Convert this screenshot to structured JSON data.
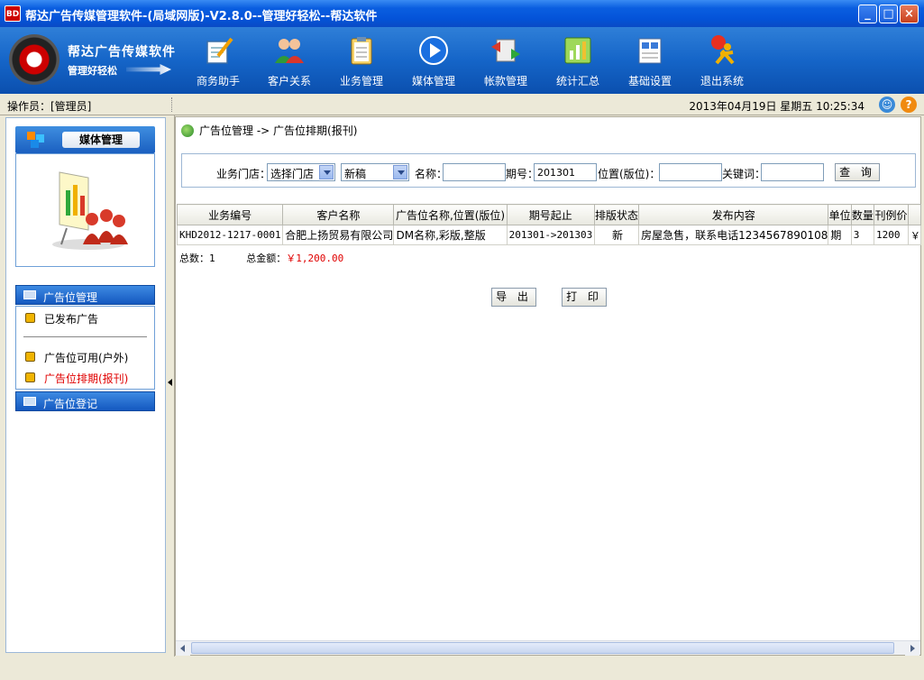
{
  "window": {
    "app_icon_text": "BD",
    "title": "帮达广告传媒管理软件-(局域网版)-V2.8.0--管理好轻松--帮达软件",
    "minimize": "_",
    "maximize": "□",
    "close": "×"
  },
  "logo": {
    "title": "帮达广告传媒软件",
    "subtitle": "管理好轻松"
  },
  "toolbar": [
    {
      "label": "商务助手",
      "icon": "notepad-pen-icon"
    },
    {
      "label": "客户关系",
      "icon": "people-icon"
    },
    {
      "label": "业务管理",
      "icon": "clipboard-icon"
    },
    {
      "label": "媒体管理",
      "icon": "play-icon"
    },
    {
      "label": "帐款管理",
      "icon": "money-transfer-icon"
    },
    {
      "label": "统计汇总",
      "icon": "chart-icon"
    },
    {
      "label": "基础设置",
      "icon": "settings-document-icon"
    },
    {
      "label": "退出系统",
      "icon": "exit-person-icon"
    }
  ],
  "status": {
    "operator": "操作员：[管理员]",
    "datetime": "2013年04月19日  星期五  10:25:34"
  },
  "sidebar": {
    "panel_title": "媒体管理",
    "sections": [
      {
        "title": "广告位管理",
        "items": [
          {
            "label": "已发布广告",
            "active": false
          },
          {
            "label": "广告位可用(户外)",
            "active": false
          },
          {
            "label": "广告位排期(报刊)",
            "active": true
          }
        ]
      },
      {
        "title": "广告位登记",
        "items": []
      }
    ]
  },
  "breadcrumb": "广告位管理 -> 广告位排期(报刊)",
  "search": {
    "store_label": "业务门店：",
    "store_value": "选择门店",
    "type_value": "新稿",
    "name_label": "名称：",
    "name_value": "",
    "issue_label": "期号：",
    "issue_value": "201301",
    "position_label": "位置(版位)：",
    "position_value": "",
    "keyword_label": "关键词：",
    "keyword_value": "",
    "query_button": "查 询"
  },
  "table": {
    "columns": [
      "业务编号",
      "客户名称",
      "广告位名称,位置(版位)",
      "期号起止",
      "排版状态",
      "发布内容",
      "单位",
      "数量",
      "刊例价",
      "￥"
    ],
    "rows": [
      [
        "KHD2012-1217-0001",
        "合肥上扬贸易有限公司",
        "DM名称,彩版,整版",
        "201301->201303",
        "新",
        "房屋急售，联系电话1234567890108",
        "期",
        "3",
        "1200",
        "￥"
      ]
    ]
  },
  "totals": {
    "count_label": "总数：",
    "count": "1",
    "amount_label": "总金额：",
    "amount": "￥1,200.00"
  },
  "actions": {
    "export": "导 出",
    "print": "打 印"
  },
  "colors": {
    "title_bar": "#0453d8",
    "header": "#1565c8",
    "accent_red": "#e00000"
  }
}
